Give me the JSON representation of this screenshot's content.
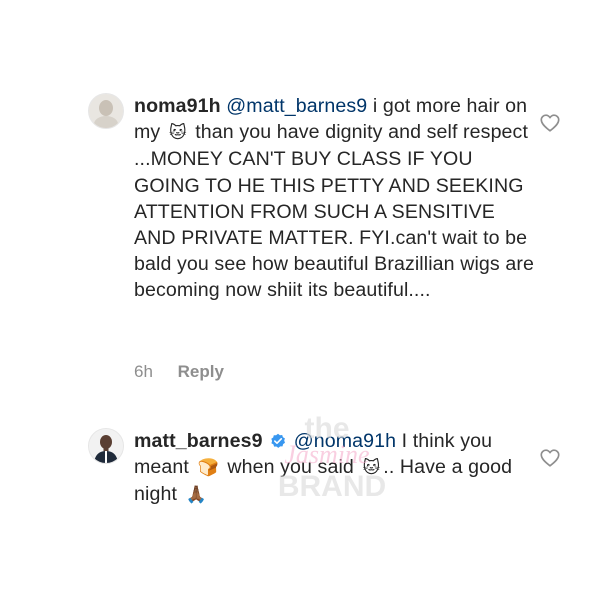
{
  "comments": [
    {
      "username": "noma91h",
      "mention": "@matt_barnes9",
      "text_part1": " i got more hair on my ",
      "emoji1": "🐱",
      "text_part2": " than you have dignity and self respect ...MONEY CAN'T BUY CLASS IF YOU GOING TO HE THIS PETTY AND SEEKING ATTENTION FROM SUCH A SENSITIVE AND PRIVATE MATTER. FYI.can't wait to be bald you see how beautiful Brazillian wigs are becoming now shiit its beautiful....",
      "time": "6h",
      "reply_label": "Reply"
    },
    {
      "username": "matt_barnes9",
      "verified": true,
      "mention": "@noma91h",
      "text_part1": " I think you meant ",
      "emoji1": "🍞",
      "text_part2": " when you said ",
      "emoji2": "🐱",
      "text_part3": ".. Have a good night ",
      "emoji3": "🙏🏾"
    }
  ],
  "watermark": {
    "line1": "the",
    "line2": "Jasmine",
    "line3": "BRAND"
  },
  "colors": {
    "mention": "#003569",
    "verified": "#3897f0",
    "meta": "#8e8e8e"
  }
}
